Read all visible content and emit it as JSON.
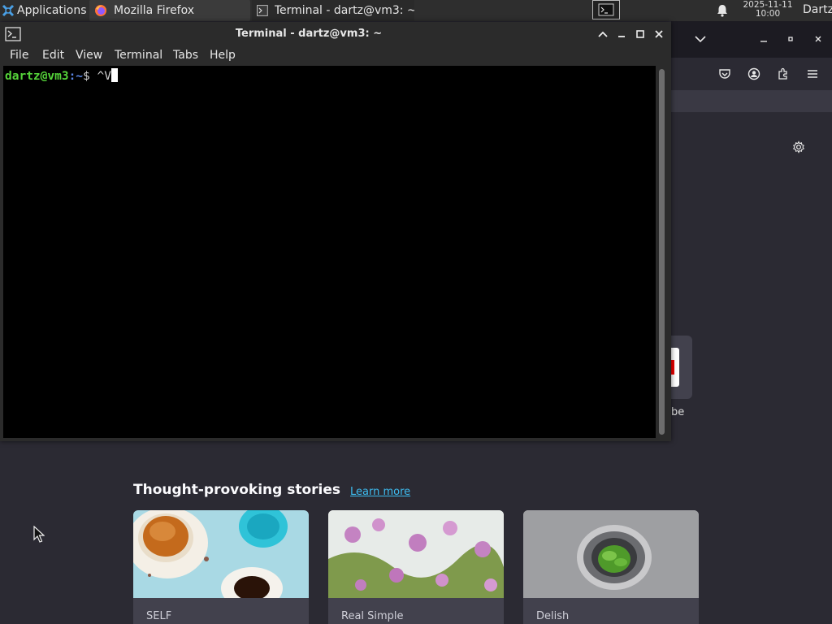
{
  "panel": {
    "applications_label": "Applications",
    "tasks": [
      {
        "label": "Mozilla Firefox"
      },
      {
        "label": "Terminal - dartz@vm3: ~"
      }
    ],
    "clock": {
      "date": "2025-11-11",
      "time": "10:00"
    },
    "user_label": "Dartz"
  },
  "terminal": {
    "title": "Terminal - dartz@vm3: ~",
    "menu": [
      "File",
      "Edit",
      "View",
      "Terminal",
      "Tabs",
      "Help"
    ],
    "prompt_user": "dartz@vm3",
    "prompt_path": ":~",
    "prompt_symbol": "$",
    "typed_text": "^V"
  },
  "firefox": {
    "shortcut_label_fragment": "be",
    "stories_title": "Thought-provoking stories",
    "learn_more": "Learn more",
    "cards": [
      {
        "source": "SELF"
      },
      {
        "source": "Real Simple"
      },
      {
        "source": "Delish"
      }
    ]
  },
  "colors": {
    "prompt_user": "#55d43a",
    "prompt_path": "#5a86e6",
    "link": "#3dbcf0",
    "ff_background": "#2b2a33"
  },
  "icons": {
    "applications": "xfce-logo-icon",
    "firefox_task": "firefox-icon",
    "terminal_task": "terminal-icon",
    "notifications": "bell-icon",
    "settings": "gear-icon"
  }
}
